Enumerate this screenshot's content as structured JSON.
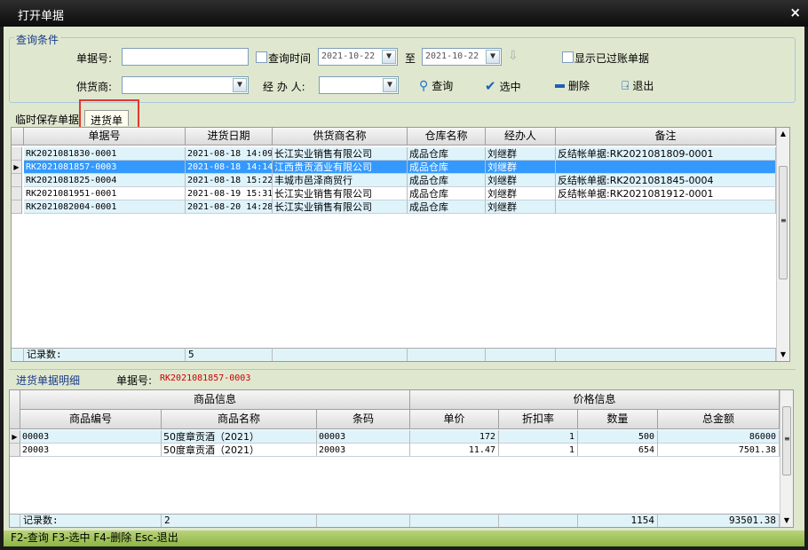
{
  "window": {
    "title": "打开单据",
    "close": "×"
  },
  "query": {
    "group_title": "查询条件",
    "doc_no_label": "单据号:",
    "doc_no_value": "",
    "query_time_label": "查询时间",
    "date_from": "2021-10-22",
    "to_label": "至",
    "date_to": "2021-10-22",
    "show_posted_label": "显示已过账单据",
    "supplier_label": "供货商:",
    "supplier_value": "",
    "handler_label": "经 办 人:",
    "handler_value": "",
    "search_btn": "查询",
    "select_btn": "选中",
    "delete_btn": "删除",
    "exit_btn": "退出"
  },
  "tabs": [
    {
      "label": "临时保存单据"
    },
    {
      "label": "进货单"
    }
  ],
  "main_grid": {
    "columns": [
      "单据号",
      "进货日期",
      "供货商名称",
      "仓库名称",
      "经办人",
      "备注"
    ],
    "rows": [
      [
        "RK2021081830-0001",
        "2021-08-18 14:09",
        "长江实业销售有限公司",
        "成品仓库",
        "刘继群",
        "反结帐单据:RK2021081809-0001"
      ],
      [
        "RK2021081857-0003",
        "2021-08-18 14:14",
        "江西贵贡酒业有限公司",
        "成品仓库",
        "刘继群",
        ""
      ],
      [
        "RK2021081825-0004",
        "2021-08-18 15:22",
        "丰城市邑泽商贸行",
        "成品仓库",
        "刘继群",
        "反结帐单据:RK2021081845-0004"
      ],
      [
        "RK2021081951-0001",
        "2021-08-19 15:31",
        "长江实业销售有限公司",
        "成品仓库",
        "刘继群",
        "反结帐单据:RK2021081912-0001"
      ],
      [
        "RK2021082004-0001",
        "2021-08-20 14:28",
        "长江实业销售有限公司",
        "成品仓库",
        "刘继群",
        ""
      ]
    ],
    "selected_index": 1,
    "footer_label": "记录数:",
    "footer_count": "5"
  },
  "detail": {
    "title": "进货单据明细",
    "doc_no_label": "单据号:",
    "doc_no_value": "RK2021081857-0003",
    "band_goods": "商品信息",
    "band_price": "价格信息",
    "columns": [
      "商品编号",
      "商品名称",
      "条码",
      "单价",
      "折扣率",
      "数量",
      "总金额"
    ],
    "rows": [
      [
        "00003",
        "50度章贡酒（2021）",
        "00003",
        "172",
        "1",
        "500",
        "86000"
      ],
      [
        "20003",
        "50度章贡酒（2021）",
        "20003",
        "11.47",
        "1",
        "654",
        "7501.38"
      ]
    ],
    "footer_label": "记录数:",
    "footer_count": "2",
    "footer_qty": "1154",
    "footer_total": "93501.38"
  },
  "statusbar": "F2-查询 F3-选中 F4-删除 Esc-退出",
  "colors": {
    "selected_row": "#3399ff",
    "accent_red": "#cc0000",
    "highlight_box": "#e0392b"
  }
}
